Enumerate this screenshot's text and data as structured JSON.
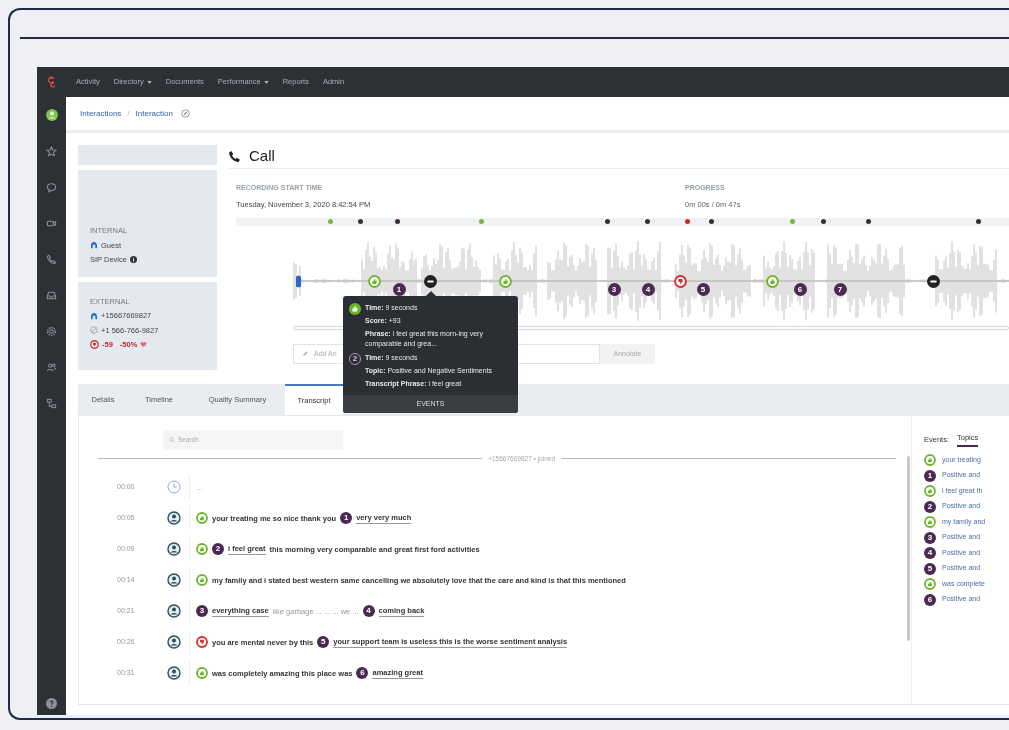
{
  "nav": {
    "items": [
      {
        "label": "Activity",
        "dropdown": false
      },
      {
        "label": "Directory",
        "dropdown": true
      },
      {
        "label": "Documents",
        "dropdown": false
      },
      {
        "label": "Performance",
        "dropdown": true
      },
      {
        "label": "Reports",
        "dropdown": false
      },
      {
        "label": "Admin",
        "dropdown": false
      }
    ]
  },
  "breadcrumb": {
    "items": [
      "Interactions",
      "Interaction"
    ],
    "separator": "/"
  },
  "participants": {
    "internal": {
      "heading": "INTERNAL",
      "name": "Guest",
      "device": "SIP Device"
    },
    "external": {
      "heading": "EXTERNAL",
      "number": "+15667669827",
      "phone": "+1 566-766-9827",
      "negative": true,
      "score": "-59",
      "percent": "-50%"
    }
  },
  "call": {
    "title": "Call",
    "recording_label": "RECORDING START TIME",
    "recording_value": "Tuesday, November 3, 2020 8:42:54 PM",
    "progress_label": "PROGRESS",
    "progress_value": "0m 00s / 0m 47s"
  },
  "waveform": {
    "dots": [
      {
        "color": "#7cb342"
      },
      {
        "color": "#3a2d3e"
      },
      {
        "color": "#3a2d3e"
      },
      {
        "color": "#7cb342"
      },
      {
        "color": "#3a2d3e"
      },
      {
        "color": "#3a2d3e"
      },
      {
        "color": "#c62828"
      },
      {
        "color": "#3a2d3e"
      },
      {
        "color": "#7cb342"
      },
      {
        "color": "#3a2d3e"
      },
      {
        "color": "#3a2d3e"
      },
      {
        "color": "#3a2d3e"
      }
    ],
    "markers": [
      {
        "kind": "start"
      },
      {
        "kind": "positive"
      },
      {
        "kind": "topic",
        "label": "1"
      },
      {
        "kind": "neutral"
      },
      {
        "kind": "positive"
      },
      {
        "kind": "topic",
        "label": "3"
      },
      {
        "kind": "topic",
        "label": "4"
      },
      {
        "kind": "negative"
      },
      {
        "kind": "topic",
        "label": "5"
      },
      {
        "kind": "positive"
      },
      {
        "kind": "topic",
        "label": "6"
      },
      {
        "kind": "topic",
        "label": "7"
      },
      {
        "kind": "neutral"
      }
    ]
  },
  "annotation": {
    "placeholder": "Add An",
    "button": "Annotate"
  },
  "tabs": [
    {
      "label": "Details",
      "selected": false
    },
    {
      "label": "Timeline",
      "selected": false
    },
    {
      "label": "Quality Summary",
      "selected": false
    },
    {
      "label": "Transcript",
      "selected": true
    }
  ],
  "tooltip": {
    "entries": [
      {
        "kind": "positive",
        "lines": [
          "**Time:** 9 seconds",
          "**Score:** +93",
          "**Phrase:** i feel great this morn-ing very comparable and grea..."
        ]
      },
      {
        "kind": "topic",
        "label": "2",
        "lines": [
          "**Time:** 9 seconds",
          "**Topic:** Positive and Negative Sentiments",
          "**Transcript Phrase:** i feel great"
        ]
      }
    ],
    "footer": "EVENTS"
  },
  "transcript": {
    "search_placeholder": "Search",
    "joined": "+15667669827 • joined",
    "rows": [
      {
        "time": "00:00",
        "kind": "system",
        "parts": [
          {
            "kind": "muted",
            "text": "..."
          }
        ]
      },
      {
        "time": "00:05",
        "kind": "speaker",
        "parts": [
          {
            "kind": "positive"
          },
          {
            "kind": "text",
            "text": "your treating me so nice thank you"
          },
          {
            "kind": "topic",
            "label": "1"
          },
          {
            "kind": "phrase",
            "text": "very very much"
          }
        ]
      },
      {
        "time": "00:09",
        "kind": "speaker",
        "parts": [
          {
            "kind": "positive"
          },
          {
            "kind": "topic",
            "label": "2"
          },
          {
            "kind": "phrase",
            "text": "i feel great"
          },
          {
            "kind": "text",
            "text": "this morning very comparable and great first ford activities"
          }
        ]
      },
      {
        "time": "00:14",
        "kind": "speaker",
        "parts": [
          {
            "kind": "positive"
          },
          {
            "kind": "text",
            "text": "my family and i stated best western same cancelling we absolutely love that the care and kind is that this mentioned"
          }
        ]
      },
      {
        "time": "00:21",
        "kind": "speaker",
        "parts": [
          {
            "kind": "topic",
            "label": "3"
          },
          {
            "kind": "phrase",
            "text": "everything case"
          },
          {
            "kind": "muted",
            "text": "like garbage ... ... ... we ..."
          },
          {
            "kind": "topic",
            "label": "4"
          },
          {
            "kind": "phrase",
            "text": "coming back"
          }
        ]
      },
      {
        "time": "00:26",
        "kind": "speaker",
        "parts": [
          {
            "kind": "negative"
          },
          {
            "kind": "text",
            "text": "you are mental never by this"
          },
          {
            "kind": "topic",
            "label": "5"
          },
          {
            "kind": "phrase",
            "text": "your support team is useless this is the worse sentiment analysis"
          }
        ]
      },
      {
        "time": "00:31",
        "kind": "speaker",
        "parts": [
          {
            "kind": "positive"
          },
          {
            "kind": "text",
            "text": "was completely amazing this place was"
          },
          {
            "kind": "topic",
            "label": "6"
          },
          {
            "kind": "phrase",
            "text": "amazing great"
          }
        ]
      }
    ]
  },
  "events_panel": {
    "label": "Events:",
    "tabs": [
      {
        "label": "Topics",
        "selected": true
      }
    ],
    "items": [
      {
        "kind": "positive",
        "text": "your treating"
      },
      {
        "kind": "topic",
        "label": "1",
        "text": "Positive and"
      },
      {
        "kind": "positive",
        "text": "i feel great th"
      },
      {
        "kind": "topic",
        "label": "2",
        "text": "Positive and"
      },
      {
        "kind": "positive",
        "text": "my family and"
      },
      {
        "kind": "topic",
        "label": "3",
        "text": "Positive and"
      },
      {
        "kind": "topic",
        "label": "4",
        "text": "Positive and"
      },
      {
        "kind": "topic",
        "label": "5",
        "text": "Positive and"
      },
      {
        "kind": "positive",
        "text": "was complete"
      },
      {
        "kind": "topic",
        "label": "6",
        "text": "Positive and"
      }
    ]
  }
}
